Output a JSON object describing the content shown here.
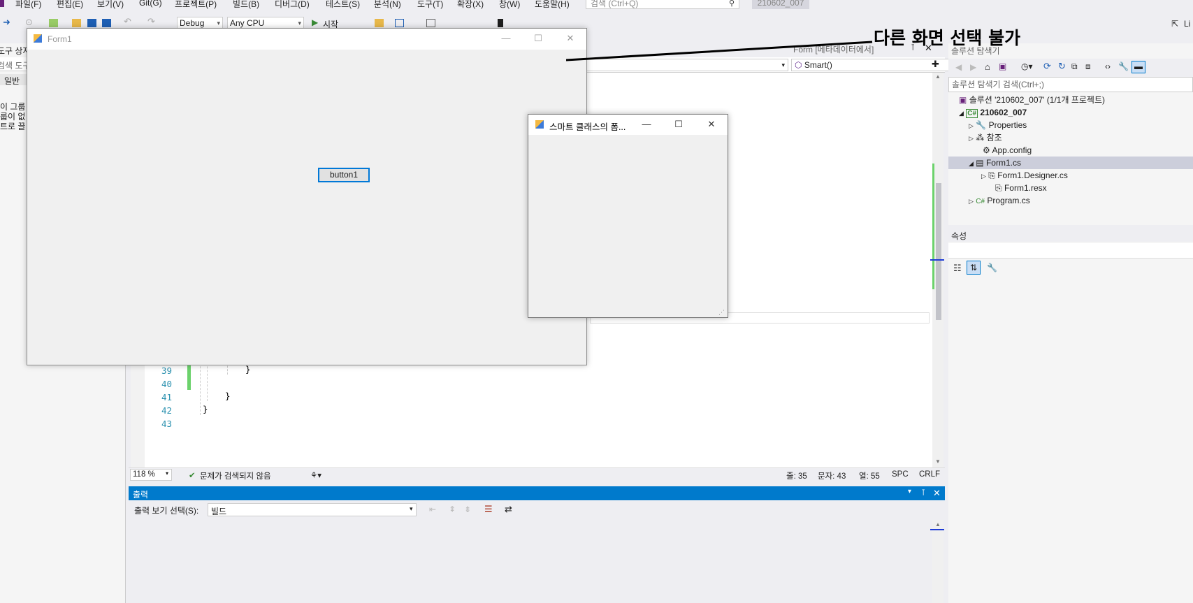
{
  "menu": {
    "items": [
      "파일(F)",
      "편집(E)",
      "보기(V)",
      "Git(G)",
      "프로젝트(P)",
      "빌드(B)",
      "디버그(D)",
      "테스트(S)",
      "분석(N)",
      "도구(T)",
      "확장(X)",
      "창(W)",
      "도움말(H)"
    ],
    "search_placeholder": "검색 (Ctrl+Q)",
    "solution_name": "210602_007"
  },
  "toolbar": {
    "config": "Debug",
    "platform": "Any CPU",
    "start_label": "시작",
    "live_label": "Li"
  },
  "toolbox": {
    "title": "도구 상자",
    "search_placeholder": "검색 도구",
    "group": "일반",
    "empty_lines": [
      "이 그룹",
      "룹이 없",
      "트로 끌"
    ]
  },
  "editor": {
    "tab_label": "Form [메타데이터에서]",
    "member_dropdown": "Smart()",
    "lines": [
      {
        "num": "39",
        "code": "}"
      },
      {
        "num": "40",
        "code": ""
      },
      {
        "num": "41",
        "code": "}"
      },
      {
        "num": "42",
        "code": "}"
      },
      {
        "num": "43",
        "code": ""
      }
    ]
  },
  "status": {
    "zoom": "118 %",
    "issues": "문제가 검색되지 않음",
    "line": "줄: 35",
    "char": "문자: 43",
    "col": "열: 55",
    "spc": "SPC",
    "crlf": "CRLF"
  },
  "output": {
    "title": "출력",
    "source_label": "출력 보기 선택(S):",
    "source_value": "빌드"
  },
  "solution_explorer": {
    "title": "솔루션 탐색기",
    "search_placeholder": "솔루션 탐색기 검색(Ctrl+;)",
    "tree": [
      {
        "label": "솔루션 '210602_007' (1/1개 프로젝트)"
      },
      {
        "label": "210602_007"
      },
      {
        "label": "Properties"
      },
      {
        "label": "참조"
      },
      {
        "label": "App.config"
      },
      {
        "label": "Form1.cs"
      },
      {
        "label": "Form1.Designer.cs"
      },
      {
        "label": "Form1.resx"
      },
      {
        "label": "Program.cs"
      }
    ]
  },
  "properties": {
    "title": "속성"
  },
  "form1": {
    "title": "Form1",
    "button_label": "button1"
  },
  "smart_window": {
    "title": "스마트 클래스의 폼..."
  },
  "annotation": {
    "text": "다른 화면 선택 불가"
  },
  "colors": {
    "accent": "#007acc",
    "selection": "#cccedb",
    "line_number": "#2b91af",
    "change_marker": "#6cd26c"
  }
}
